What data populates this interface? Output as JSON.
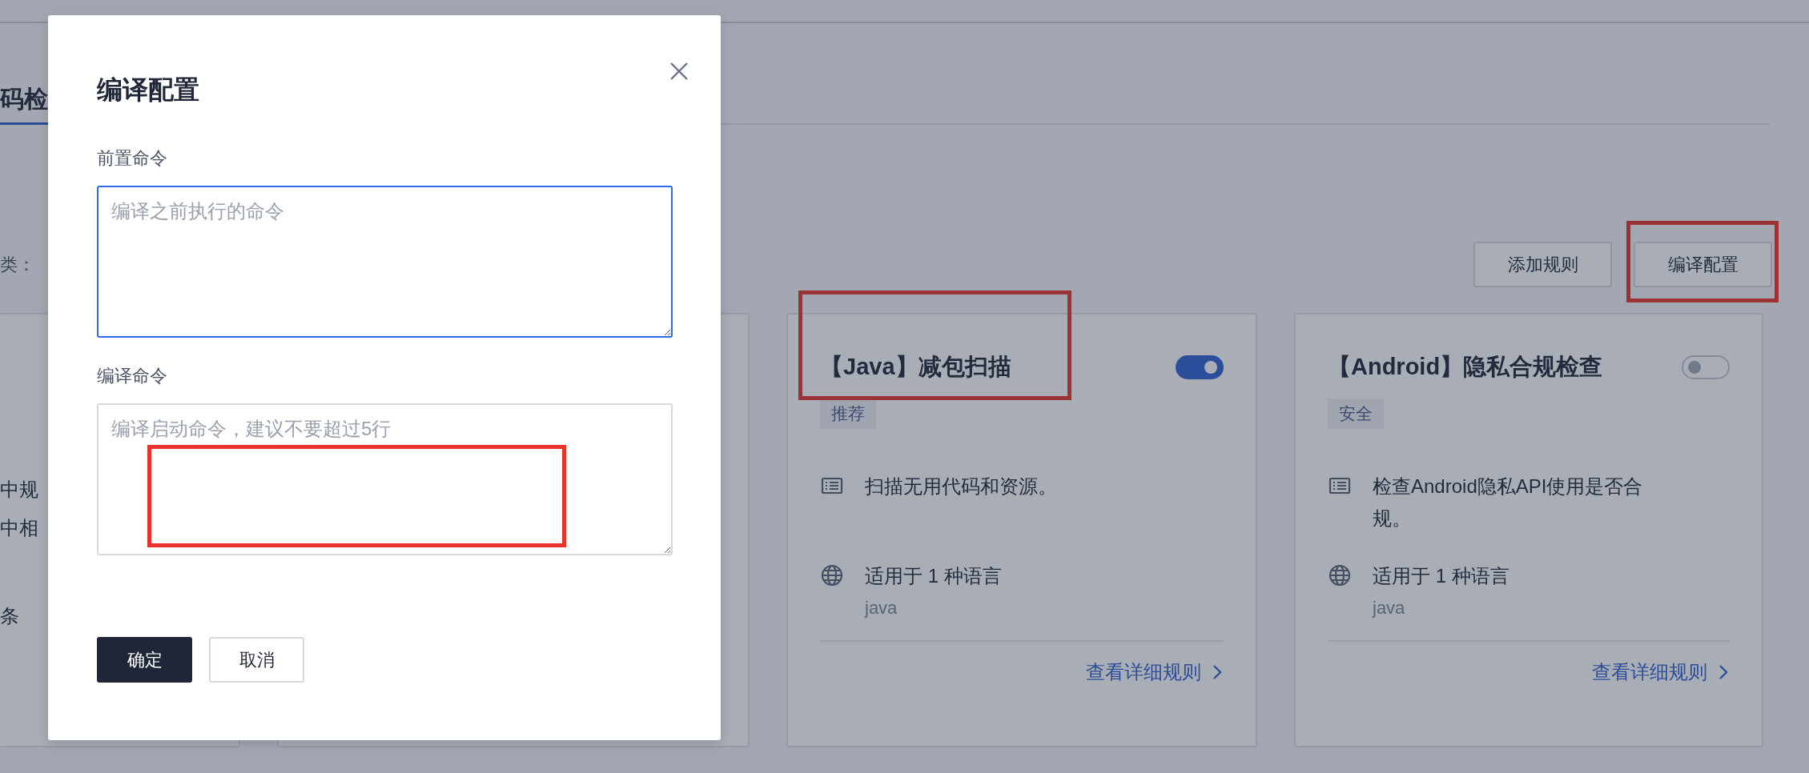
{
  "background": {
    "tab": {
      "label": "码检",
      "selected": true
    },
    "filter_label": "类：",
    "toolbar_buttons": [
      {
        "label": "添加规则",
        "highlighted": false
      },
      {
        "label": "编译配置",
        "highlighted": true
      }
    ],
    "partial_card": {
      "lines": [
        "中规",
        "中相",
        "条"
      ]
    },
    "rule_cards": [
      {
        "title": "【Java】减包扫描",
        "enabled": true,
        "tag": "推荐",
        "description": "扫描无用代码和资源。",
        "languages": "适用于 1 种语言",
        "language_list": "java",
        "link": "查看详细规则",
        "highlighted": true
      },
      {
        "title": "【Android】隐私合规检查",
        "enabled": false,
        "tag": "安全",
        "description": "检查Android隐私API使用是否合规。",
        "languages": "适用于 1 种语言",
        "language_list": "java",
        "link": "查看详细规则",
        "highlighted": false
      }
    ]
  },
  "dialog": {
    "title": "编译配置",
    "fields": [
      {
        "label": "前置命令",
        "placeholder": "编译之前执行的命令",
        "focused": true,
        "highlighted": false
      },
      {
        "label": "编译命令",
        "placeholder": "编译启动命令，建议不要超过5行",
        "focused": false,
        "highlighted": true
      }
    ],
    "buttons": [
      {
        "label": "确定",
        "kind": "primary"
      },
      {
        "label": "取消",
        "kind": "secondary"
      }
    ]
  }
}
